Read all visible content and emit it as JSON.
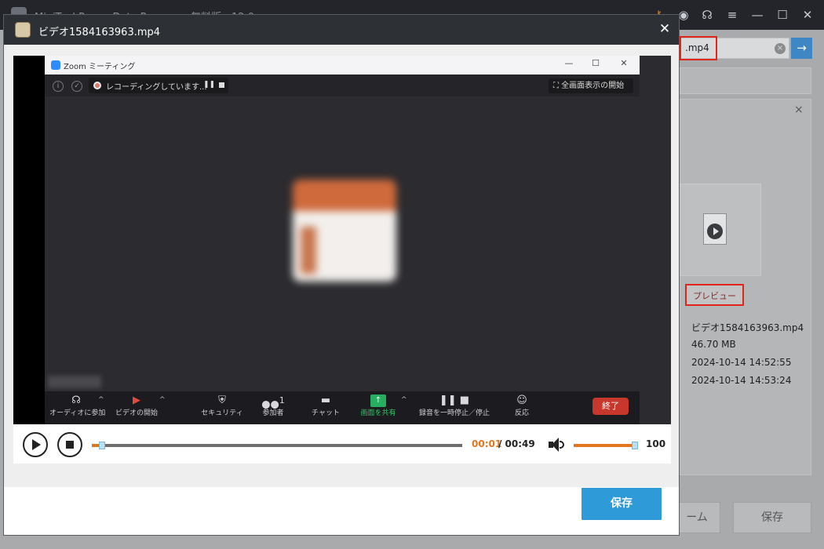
{
  "app": {
    "title": "MiniTool Power Data Recovery 無料版 - 12.0",
    "search_value": ".mp4",
    "search_go": "→",
    "search_clear": "×",
    "detail_close": "×",
    "preview_label": "プレビュー",
    "file_info": {
      "name": "ビデオ1584163963.mp4",
      "size": "46.70 MB",
      "created": "2024-10-14 14:52:55",
      "modified": "2024-10-14 14:53:24"
    },
    "bottom_buttons": {
      "partial_label": "ーム",
      "save_label": "保存"
    },
    "controls": {
      "key": "⚷",
      "disc": "◉",
      "headset": "☊",
      "menu": "≡",
      "minimize": "—",
      "maximize": "☐",
      "close": "✕"
    }
  },
  "modal": {
    "title": "ビデオ1584163963.mp4",
    "close": "✕",
    "save_label": "保存"
  },
  "video": {
    "zoom_window_title": "Zoom ミーティング",
    "recording_text": "レコーディングしています...",
    "recording_pause": "❚❚",
    "fullscreen_label": "⛶ 全画面表示の開始",
    "toolbar": [
      {
        "name": "audio",
        "label": "オーディオに参加",
        "glyph": "☊"
      },
      {
        "name": "video",
        "label": "ビデオの開始",
        "glyph": "▶"
      },
      {
        "name": "security",
        "label": "セキュリティ",
        "glyph": "⛨"
      },
      {
        "name": "participants",
        "label": "参加者",
        "glyph": "👥"
      },
      {
        "name": "chat",
        "label": "チャット",
        "glyph": "▬"
      },
      {
        "name": "share",
        "label": "画面を共有",
        "glyph": "↑"
      },
      {
        "name": "record",
        "label": "録音を一時停止／停止",
        "glyph": "❚❚ ■"
      },
      {
        "name": "reactions",
        "label": "反応",
        "glyph": "☺"
      }
    ],
    "participant_count": "1",
    "end_label": "終了"
  },
  "player": {
    "current_time": "00:01",
    "total_time": "/ 00:49",
    "progress_fraction": 0.02,
    "volume": "100",
    "volume_fraction": 1.0
  }
}
